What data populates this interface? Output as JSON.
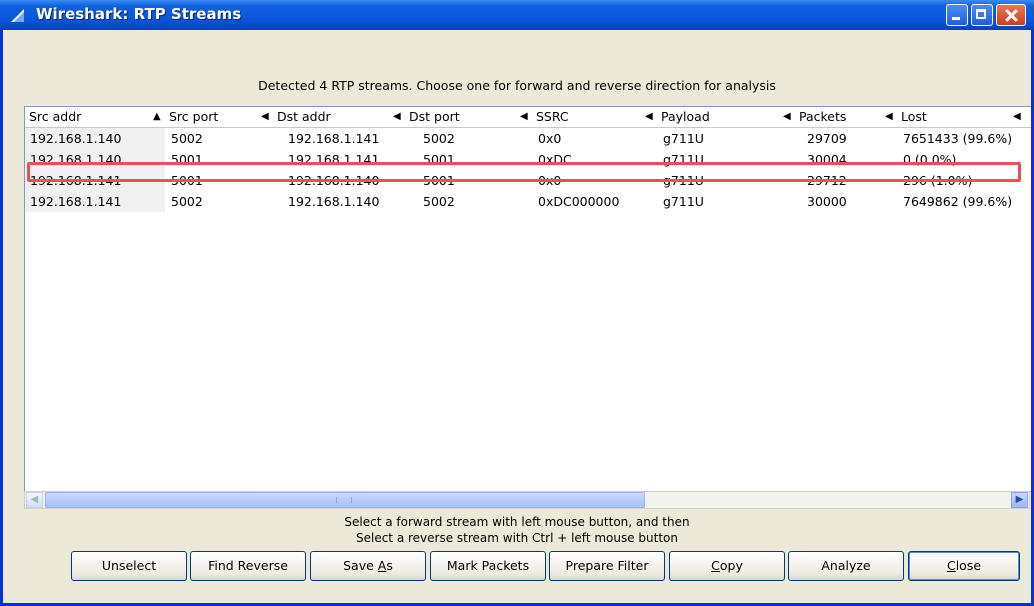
{
  "window": {
    "title": "Wireshark: RTP Streams"
  },
  "info_text": "Detected 4 RTP streams. Choose one for forward and reverse direction for analysis",
  "table": {
    "columns": [
      "Src addr",
      "Src port",
      "Dst addr",
      "Dst port",
      "SSRC",
      "Payload",
      "Packets",
      "Lost"
    ],
    "rows": [
      [
        "192.168.1.140",
        "5002",
        "192.168.1.141",
        "5002",
        "0x0",
        "g711U",
        "29709",
        "7651433 (99.6%)"
      ],
      [
        "192.168.1.140",
        "5001",
        "192.168.1.141",
        "5001",
        "0xDC",
        "g711U",
        "30004",
        "0 (0.0%)"
      ],
      [
        "192.168.1.141",
        "5001",
        "192.168.1.140",
        "5001",
        "0x0",
        "g711U",
        "29712",
        "296 (1.0%)"
      ],
      [
        "192.168.1.141",
        "5002",
        "192.168.1.140",
        "5002",
        "0xDC000000",
        "g711U",
        "30000",
        "7649862 (99.6%)"
      ]
    ],
    "highlighted_row": 2
  },
  "hint": {
    "line1": "Select a forward stream with left mouse button, and then",
    "line2": "Select a reverse stream with Ctrl + left mouse button"
  },
  "buttons": {
    "unselect": "Unselect",
    "find_reverse": "Find Reverse",
    "save_as_pre": "Save ",
    "save_as_u": "A",
    "save_as_post": "s",
    "mark_packets": "Mark Packets",
    "prepare_filter": "Prepare Filter",
    "copy_u": "C",
    "copy_post": "opy",
    "analyze": "Analyze",
    "close_u": "C",
    "close_post": "lose"
  },
  "colors": {
    "highlight_border": "#e8505a",
    "titlebar": "#0a54d6"
  }
}
